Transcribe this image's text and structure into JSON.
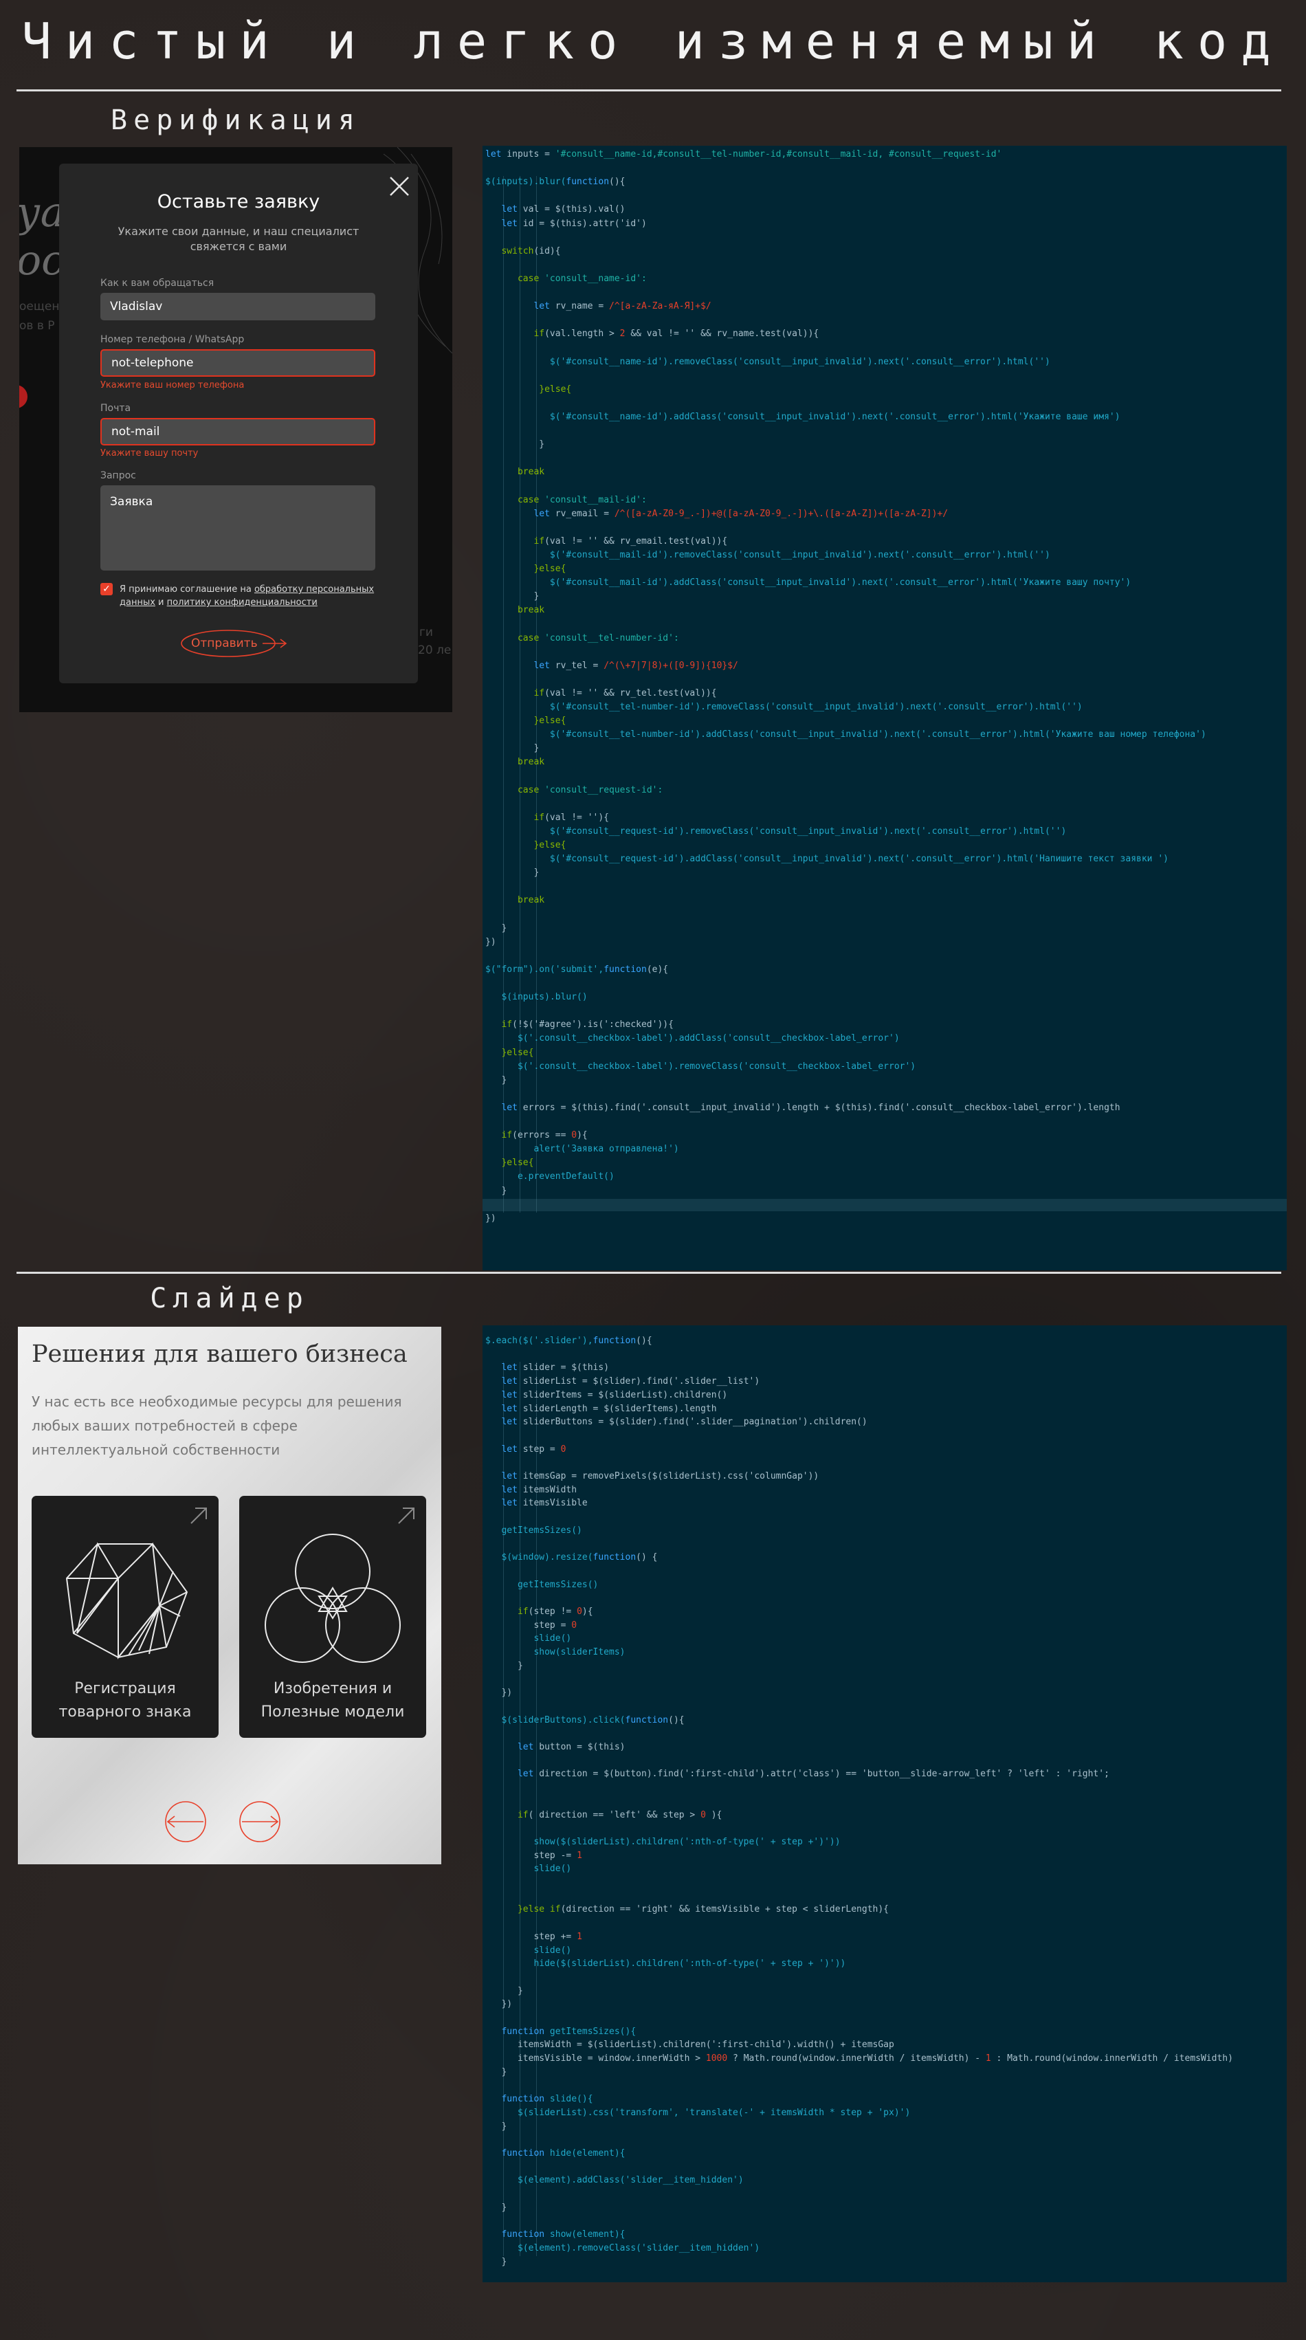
{
  "page": {
    "title": "Чистый и легко изменяемый код",
    "sections": {
      "verification": "Верификация",
      "slider": "Слайдер"
    }
  },
  "colors": {
    "background": "#2a2422",
    "code_bg": "#012634",
    "accent": "#e8402a"
  },
  "verification": {
    "bg_text_1": "уал",
    "bg_text_2": "ост",
    "bg_line_1": "оещени",
    "bg_line_2": "ов в Р",
    "bg_line_3": "ги",
    "bg_line_4": "20 ле",
    "modal": {
      "title": "Оставьте заявку",
      "subtitle": "Укажите свои данные, и наш специалист свяжется с вами",
      "name_label": "Как к вам обращаться",
      "name_value": "Vladislav",
      "phone_label": "Номер телефона / WhatsApp",
      "phone_value": "not-telephone",
      "phone_error": "Укажите ваш номер телефона",
      "mail_label": "Почта",
      "mail_value": "not-mail",
      "mail_error": "Укажите вашу почту",
      "request_label": "Запрос",
      "request_value": "Заявка",
      "agree_prefix": "Я принимаю соглашение на ",
      "agree_link_1": "обработку персональных данных",
      "agree_and": " и ",
      "agree_link_2": "политику конфиденциальности",
      "send_label": "Отправить"
    }
  },
  "slider": {
    "title": "Решения для вашего бизнеса",
    "subtitle": "У нас есть все необходимые ресурсы для решения любых ваших потребностей в сфере интеллектуальной собственности",
    "cards": [
      {
        "label": "Регистрация товарного знака",
        "icon": "polyhedron-icon"
      },
      {
        "label": "Изобретения и Полезные модели",
        "icon": "circles-icon"
      }
    ]
  },
  "code": {
    "verification": [
      [
        {
          "t": "let",
          "c": "k"
        },
        {
          "t": " inputs = ",
          "c": "p"
        },
        {
          "t": "'#consult__name-id,#consult__tel-number-id,#consult__mail-id, #consult__request-id'",
          "c": "s"
        }
      ],
      [],
      [
        {
          "t": "$(inputs).blur(",
          "c": "f"
        },
        {
          "t": "function",
          "c": "k"
        },
        {
          "t": "(){",
          "c": "p"
        }
      ],
      [],
      [
        {
          "t": "   let",
          "c": "k"
        },
        {
          "t": " val = $(this).val()",
          "c": "p"
        }
      ],
      [
        {
          "t": "   let",
          "c": "k"
        },
        {
          "t": " id = $(this).attr('id')",
          "c": "p"
        }
      ],
      [],
      [
        {
          "t": "   switch",
          "c": "g"
        },
        {
          "t": "(id){",
          "c": "p"
        }
      ],
      [],
      [
        {
          "t": "      case",
          "c": "g"
        },
        {
          "t": " 'consult__name-id':",
          "c": "s"
        }
      ],
      [],
      [
        {
          "t": "         let",
          "c": "k"
        },
        {
          "t": " rv_name = ",
          "c": "p"
        },
        {
          "t": "/^[a-zA-Za-яА-Я]+$/",
          "c": "r"
        }
      ],
      [],
      [
        {
          "t": "         if",
          "c": "g"
        },
        {
          "t": "(val.length > ",
          "c": "p"
        },
        {
          "t": "2",
          "c": "r"
        },
        {
          "t": " && val != '' && rv_name.test(val)){",
          "c": "p"
        }
      ],
      [],
      [
        {
          "t": "            $('#consult__name-id').removeClass('consult__input_invalid').next('.consult__error').html('')",
          "c": "f"
        }
      ],
      [],
      [
        {
          "t": "          }else{",
          "c": "g"
        }
      ],
      [],
      [
        {
          "t": "            $('#consult__name-id').addClass('consult__input_invalid').next('.consult__error').html('Укажите ваше имя')",
          "c": "f"
        }
      ],
      [],
      [
        {
          "t": "          }",
          "c": "p"
        }
      ],
      [],
      [
        {
          "t": "      break",
          "c": "g"
        }
      ],
      [],
      [
        {
          "t": "      case",
          "c": "g"
        },
        {
          "t": " 'consult__mail-id':",
          "c": "s"
        }
      ],
      [
        {
          "t": "         let",
          "c": "k"
        },
        {
          "t": " rv_email = ",
          "c": "p"
        },
        {
          "t": "/^([a-zA-Z0-9_.-])+@([a-zA-Z0-9_.-])+\\.([a-zA-Z])+([a-zA-Z])+/",
          "c": "r"
        }
      ],
      [],
      [
        {
          "t": "         if",
          "c": "g"
        },
        {
          "t": "(val != '' && rv_email.test(val)){",
          "c": "p"
        }
      ],
      [
        {
          "t": "            $('#consult__mail-id').removeClass('consult__input_invalid').next('.consult__error').html('')",
          "c": "f"
        }
      ],
      [
        {
          "t": "         }else{",
          "c": "g"
        }
      ],
      [
        {
          "t": "            $('#consult__mail-id').addClass('consult__input_invalid').next('.consult__error').html('Укажите вашу почту')",
          "c": "f"
        }
      ],
      [
        {
          "t": "         }",
          "c": "p"
        }
      ],
      [
        {
          "t": "      break",
          "c": "g"
        }
      ],
      [],
      [
        {
          "t": "      case",
          "c": "g"
        },
        {
          "t": " 'consult__tel-number-id':",
          "c": "s"
        }
      ],
      [],
      [
        {
          "t": "         let",
          "c": "k"
        },
        {
          "t": " rv_tel = ",
          "c": "p"
        },
        {
          "t": "/^(\\+7|7|8)+([0-9]){10}$/",
          "c": "r"
        }
      ],
      [],
      [
        {
          "t": "         if",
          "c": "g"
        },
        {
          "t": "(val != '' && rv_tel.test(val)){",
          "c": "p"
        }
      ],
      [
        {
          "t": "            $('#consult__tel-number-id').removeClass('consult__input_invalid').next('.consult__error').html('')",
          "c": "f"
        }
      ],
      [
        {
          "t": "         }else{",
          "c": "g"
        }
      ],
      [
        {
          "t": "            $('#consult__tel-number-id').addClass('consult__input_invalid').next('.consult__error').html('Укажите ваш номер телефона')",
          "c": "f"
        }
      ],
      [
        {
          "t": "         }",
          "c": "p"
        }
      ],
      [
        {
          "t": "      break",
          "c": "g"
        }
      ],
      [],
      [
        {
          "t": "      case",
          "c": "g"
        },
        {
          "t": " 'consult__request-id':",
          "c": "s"
        }
      ],
      [],
      [
        {
          "t": "         if",
          "c": "g"
        },
        {
          "t": "(val != ''){",
          "c": "p"
        }
      ],
      [
        {
          "t": "            $('#consult__request-id').removeClass('consult__input_invalid').next('.consult__error').html('')",
          "c": "f"
        }
      ],
      [
        {
          "t": "         }else{",
          "c": "g"
        }
      ],
      [
        {
          "t": "            $('#consult__request-id').addClass('consult__input_invalid').next('.consult__error').html('Напишите текст заявки ')",
          "c": "f"
        }
      ],
      [
        {
          "t": "         }",
          "c": "p"
        }
      ],
      [],
      [
        {
          "t": "      break",
          "c": "g"
        }
      ],
      [],
      [
        {
          "t": "   }",
          "c": "p"
        }
      ],
      [
        {
          "t": "})",
          "c": "p"
        }
      ],
      [],
      [
        {
          "t": "$(\"form\").on('submit',",
          "c": "f"
        },
        {
          "t": "function",
          "c": "k"
        },
        {
          "t": "(e){",
          "c": "p"
        }
      ],
      [],
      [
        {
          "t": "   $(inputs).blur()",
          "c": "f"
        }
      ],
      [],
      [
        {
          "t": "   if",
          "c": "g"
        },
        {
          "t": "(!$('#agree').is(':checked')){",
          "c": "p"
        }
      ],
      [
        {
          "t": "      $('.consult__checkbox-label').addClass('consult__checkbox-label_error')",
          "c": "f"
        }
      ],
      [
        {
          "t": "   }else{",
          "c": "g"
        }
      ],
      [
        {
          "t": "      $('.consult__checkbox-label').removeClass('consult__checkbox-label_error')",
          "c": "f"
        }
      ],
      [
        {
          "t": "   }",
          "c": "p"
        }
      ],
      [],
      [
        {
          "t": "   let",
          "c": "k"
        },
        {
          "t": " errors = $(this).find('.consult__input_invalid').length + $(this).find('.consult__checkbox-label_error').length",
          "c": "p"
        }
      ],
      [],
      [
        {
          "t": "   if",
          "c": "g"
        },
        {
          "t": "(errors == ",
          "c": "p"
        },
        {
          "t": "0",
          "c": "r"
        },
        {
          "t": "){",
          "c": "p"
        }
      ],
      [
        {
          "t": "         alert('Заявка отправлена!')",
          "c": "f"
        }
      ],
      [
        {
          "t": "   }else{",
          "c": "g"
        }
      ],
      [
        {
          "t": "      e.preventDefault()",
          "c": "f"
        }
      ],
      [
        {
          "t": "   }",
          "c": "p"
        }
      ],
      [],
      [
        {
          "t": "})",
          "c": "p"
        }
      ]
    ],
    "slider": [
      [
        {
          "t": "$.each($('.slider'),",
          "c": "f"
        },
        {
          "t": "function",
          "c": "k"
        },
        {
          "t": "(){",
          "c": "p"
        }
      ],
      [],
      [
        {
          "t": "   let",
          "c": "k"
        },
        {
          "t": " slider = $(this)",
          "c": "p"
        }
      ],
      [
        {
          "t": "   let",
          "c": "k"
        },
        {
          "t": " sliderList = $(slider).find('.slider__list')",
          "c": "p"
        }
      ],
      [
        {
          "t": "   let",
          "c": "k"
        },
        {
          "t": " sliderItems = $(sliderList).children()",
          "c": "p"
        }
      ],
      [
        {
          "t": "   let",
          "c": "k"
        },
        {
          "t": " sliderLength = $(sliderItems).length",
          "c": "p"
        }
      ],
      [
        {
          "t": "   let",
          "c": "k"
        },
        {
          "t": " sliderButtons = $(slider).find('.slider__pagination').children()",
          "c": "p"
        }
      ],
      [],
      [
        {
          "t": "   let",
          "c": "k"
        },
        {
          "t": " step = ",
          "c": "p"
        },
        {
          "t": "0",
          "c": "r"
        }
      ],
      [],
      [
        {
          "t": "   let",
          "c": "k"
        },
        {
          "t": " itemsGap = removePixels($(sliderList).css('columnGap'))",
          "c": "p"
        }
      ],
      [
        {
          "t": "   let",
          "c": "k"
        },
        {
          "t": " itemsWidth",
          "c": "p"
        }
      ],
      [
        {
          "t": "   let",
          "c": "k"
        },
        {
          "t": " itemsVisible",
          "c": "p"
        }
      ],
      [],
      [
        {
          "t": "   getItemsSizes()",
          "c": "f"
        }
      ],
      [],
      [
        {
          "t": "   $(window).resize(",
          "c": "f"
        },
        {
          "t": "function",
          "c": "k"
        },
        {
          "t": "() {",
          "c": "p"
        }
      ],
      [],
      [
        {
          "t": "      getItemsSizes()",
          "c": "f"
        }
      ],
      [],
      [
        {
          "t": "      if",
          "c": "g"
        },
        {
          "t": "(step != ",
          "c": "p"
        },
        {
          "t": "0",
          "c": "r"
        },
        {
          "t": "){",
          "c": "p"
        }
      ],
      [
        {
          "t": "         step = ",
          "c": "p"
        },
        {
          "t": "0",
          "c": "r"
        }
      ],
      [
        {
          "t": "         slide()",
          "c": "f"
        }
      ],
      [
        {
          "t": "         show(sliderItems)",
          "c": "f"
        }
      ],
      [
        {
          "t": "      }",
          "c": "p"
        }
      ],
      [],
      [
        {
          "t": "   })",
          "c": "p"
        }
      ],
      [],
      [
        {
          "t": "   $(sliderButtons).click(",
          "c": "f"
        },
        {
          "t": "function",
          "c": "k"
        },
        {
          "t": "(){",
          "c": "p"
        }
      ],
      [],
      [
        {
          "t": "      let",
          "c": "k"
        },
        {
          "t": " button = $(this)",
          "c": "p"
        }
      ],
      [],
      [
        {
          "t": "      let",
          "c": "k"
        },
        {
          "t": " direction = $(button).find(':first-child').attr('class') == 'button__slide-arrow_left' ? 'left' : 'right';",
          "c": "p"
        }
      ],
      [],
      [],
      [
        {
          "t": "      if",
          "c": "g"
        },
        {
          "t": "( direction == 'left' && step > ",
          "c": "p"
        },
        {
          "t": "0",
          "c": "r"
        },
        {
          "t": " ){",
          "c": "p"
        }
      ],
      [],
      [
        {
          "t": "         show($(sliderList).children(':nth-of-type(' + step +')'))",
          "c": "f"
        }
      ],
      [
        {
          "t": "         step -= ",
          "c": "p"
        },
        {
          "t": "1",
          "c": "r"
        }
      ],
      [
        {
          "t": "         slide()",
          "c": "f"
        }
      ],
      [],
      [],
      [
        {
          "t": "      }else if",
          "c": "g"
        },
        {
          "t": "(direction == 'right' && itemsVisible + step < sliderLength){",
          "c": "p"
        }
      ],
      [],
      [
        {
          "t": "         step += ",
          "c": "p"
        },
        {
          "t": "1",
          "c": "r"
        }
      ],
      [
        {
          "t": "         slide()",
          "c": "f"
        }
      ],
      [
        {
          "t": "         hide($(sliderList).children(':nth-of-type(' + step + ')'))",
          "c": "f"
        }
      ],
      [],
      [
        {
          "t": "      }",
          "c": "p"
        }
      ],
      [
        {
          "t": "   })",
          "c": "p"
        }
      ],
      [],
      [
        {
          "t": "   function",
          "c": "k"
        },
        {
          "t": " getItemsSizes(){",
          "c": "f"
        }
      ],
      [
        {
          "t": "      itemsWidth = $(sliderList).children(':first-child').width() + itemsGap",
          "c": "p"
        }
      ],
      [
        {
          "t": "      itemsVisible = window.innerWidth > ",
          "c": "p"
        },
        {
          "t": "1000",
          "c": "r"
        },
        {
          "t": " ? Math.round(window.innerWidth / itemsWidth) - ",
          "c": "p"
        },
        {
          "t": "1",
          "c": "r"
        },
        {
          "t": " : Math.round(window.innerWidth / itemsWidth)",
          "c": "p"
        }
      ],
      [
        {
          "t": "   }",
          "c": "p"
        }
      ],
      [],
      [
        {
          "t": "   function",
          "c": "k"
        },
        {
          "t": " slide(){",
          "c": "f"
        }
      ],
      [
        {
          "t": "      $(sliderList).css('transform', 'translate(-' + itemsWidth * step + 'px)')",
          "c": "f"
        }
      ],
      [
        {
          "t": "   }",
          "c": "p"
        }
      ],
      [],
      [
        {
          "t": "   function",
          "c": "k"
        },
        {
          "t": " hide(element){",
          "c": "f"
        }
      ],
      [],
      [
        {
          "t": "      $(element).addClass('slider__item_hidden')",
          "c": "f"
        }
      ],
      [],
      [
        {
          "t": "   }",
          "c": "p"
        }
      ],
      [],
      [
        {
          "t": "   function",
          "c": "k"
        },
        {
          "t": " show(element){",
          "c": "f"
        }
      ],
      [
        {
          "t": "      $(element).removeClass('slider__item_hidden')",
          "c": "f"
        }
      ],
      [
        {
          "t": "   }",
          "c": "p"
        }
      ]
    ]
  }
}
